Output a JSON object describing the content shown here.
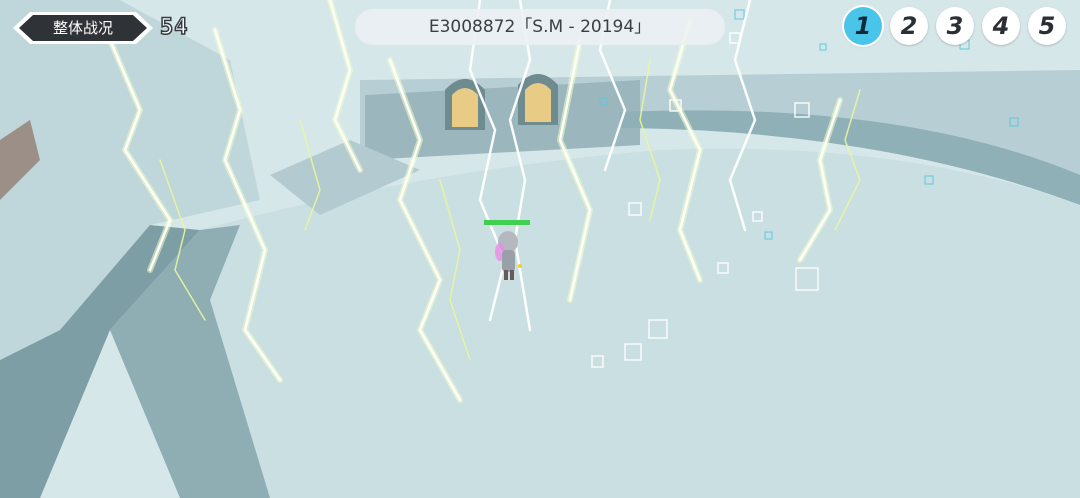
{
  "hud": {
    "overview_label": "整体战况",
    "count": "54",
    "stage_title": "E3008872「S.M - 20194」"
  },
  "waves": {
    "items": [
      "1",
      "2",
      "3",
      "4",
      "5"
    ],
    "active": "1"
  },
  "character": {
    "hp_fraction": 1.0
  },
  "icons": {
    "overview": "hexagon-button",
    "wave": "number-circle"
  },
  "colors": {
    "ground": "#c9dfe2",
    "wall": "#8fb0b7",
    "active_wave": "#49c5ea",
    "hp": "#3fd050",
    "lightning": "#f4ffd0"
  }
}
